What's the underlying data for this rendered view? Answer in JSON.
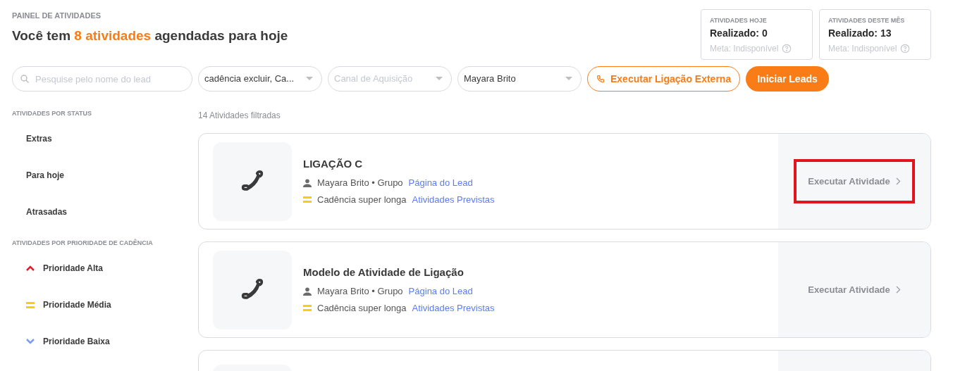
{
  "header": {
    "eyebrow": "PAINEL DE ATIVIDADES",
    "title": "Você tem **8 atividades** agendadas para hoje"
  },
  "stats": [
    {
      "label": "ATIVIDADES HOJE",
      "value": "Realizado: 0",
      "meta": "Meta: Indisponível"
    },
    {
      "label": "ATIVIDADES DESTE MÊS",
      "value": "Realizado: 13",
      "meta": "Meta: Indisponível"
    }
  ],
  "filters": {
    "search": {
      "placeholder": "Pesquise pelo nome do lead"
    },
    "selects": [
      {
        "value": "cadência excluir, Ca..."
      },
      {
        "placeholder": "Canal de Aquisição"
      },
      {
        "value": "Mayara Brito"
      }
    ],
    "buttons": [
      {
        "label": "Executar Ligação Externa",
        "kind": "outline"
      },
      {
        "label": "Iniciar Leads",
        "kind": "solid"
      }
    ]
  },
  "sidebar": {
    "sections": [
      {
        "title": "ATIVIDADES POR STATUS",
        "items": [
          {
            "label": "Extras",
            "kind": "plain"
          },
          {
            "label": "Para hoje",
            "kind": "plain"
          },
          {
            "label": "Atrasadas",
            "kind": "plain"
          }
        ]
      },
      {
        "title": "ATIVIDADES POR PRIORIDADE DE CADÊNCIA",
        "items": [
          {
            "label": "Prioridade Alta",
            "kind": "high"
          },
          {
            "label": "Prioridade Média",
            "kind": "medium"
          },
          {
            "label": "Prioridade Baixa",
            "kind": "low"
          }
        ]
      }
    ]
  },
  "list": {
    "count": "14 Atividades filtradas",
    "cards": [
      {
        "kind": "activity",
        "title": "LIGAÇÃO C",
        "owner": "Mayara Brito • Grupo",
        "lead_link": "Página do Lead",
        "cadence": "Cadência super longa",
        "cadence_link": "Atividades Previstas",
        "action": "Executar Atividade",
        "highlighted": true
      },
      {
        "kind": "activity",
        "title": "Modelo de Atividade de Ligação",
        "owner": "Mayara Brito • Grupo",
        "lead_link": "Página do Lead",
        "cadence": "Cadência super longa",
        "cadence_link": "Atividades Previstas",
        "action": "Executar Atividade",
        "highlighted": false
      },
      {
        "kind": "cut"
      }
    ]
  }
}
